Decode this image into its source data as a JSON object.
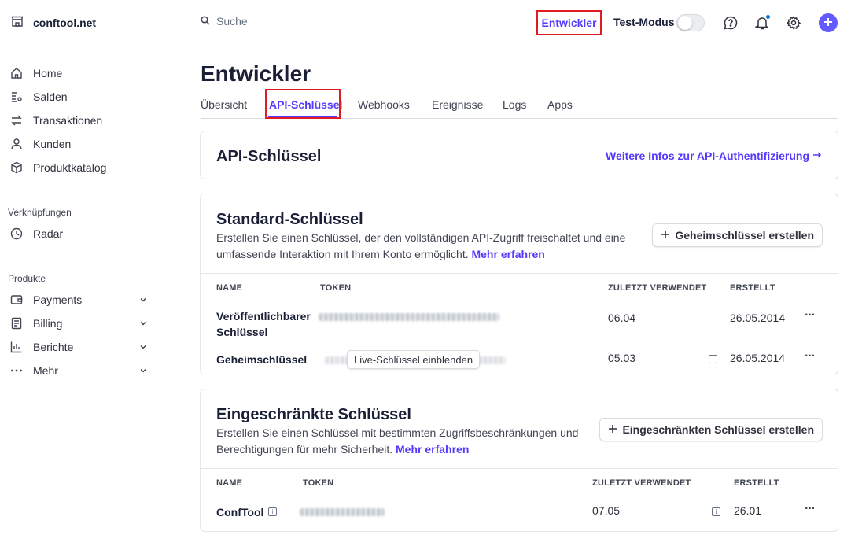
{
  "sidebar": {
    "account_name": "conftool.net",
    "nav": [
      {
        "label": "Home"
      },
      {
        "label": "Salden"
      },
      {
        "label": "Transaktionen"
      },
      {
        "label": "Kunden"
      },
      {
        "label": "Produktkatalog"
      }
    ],
    "shortcuts_label": "Verknüpfungen",
    "shortcuts": [
      {
        "label": "Radar"
      }
    ],
    "products_label": "Produkte",
    "products": [
      {
        "label": "Payments"
      },
      {
        "label": "Billing"
      },
      {
        "label": "Berichte"
      },
      {
        "label": "Mehr"
      }
    ]
  },
  "topbar": {
    "search_placeholder": "Suche",
    "developer_link": "Entwickler",
    "test_mode_label": "Test-Modus",
    "test_mode_on": false
  },
  "page": {
    "title": "Entwickler",
    "tabs": [
      {
        "label": "Übersicht"
      },
      {
        "label": "API-Schlüssel"
      },
      {
        "label": "Webhooks"
      },
      {
        "label": "Ereignisse"
      },
      {
        "label": "Logs"
      },
      {
        "label": "Apps"
      }
    ],
    "active_tab": "API-Schlüssel"
  },
  "api_card": {
    "title": "API-Schlüssel",
    "info_link": "Weitere Infos zur API-Authentifizierung"
  },
  "standard": {
    "title": "Standard-Schlüssel",
    "desc_line1": "Erstellen Sie einen Schlüssel, der den vollständigen API-Zugriff freischaltet und eine",
    "desc_line2": "umfassende Interaktion mit Ihrem Konto ermöglicht.",
    "learn_more": "Mehr erfahren",
    "button": "Geheimschlüssel erstellen",
    "columns": [
      "NAME",
      "TOKEN",
      "ZULETZT VERWENDET",
      "ERSTELLT"
    ],
    "rows": [
      {
        "name_line1": "Veröffentlichbarer",
        "name_line2": "Schlüssel",
        "last_used": "06.04",
        "created": "26.05.2014"
      },
      {
        "name": "Geheimschlüssel",
        "reveal": "Live-Schlüssel einblenden",
        "last_used": "05.03",
        "created": "26.05.2014"
      }
    ]
  },
  "restricted": {
    "title": "Eingeschränkte Schlüssel",
    "desc_line1": "Erstellen Sie einen Schlüssel mit bestimmten Zugriffsbeschränkungen und",
    "desc_line2": "Berechtigungen für mehr Sicherheit.",
    "learn_more": "Mehr erfahren",
    "button": "Eingeschränkten Schlüssel erstellen",
    "columns": [
      "NAME",
      "TOKEN",
      "ZULETZT VERWENDET",
      "ERSTELLT"
    ],
    "rows": [
      {
        "name": "ConfTool",
        "last_used": "07.05",
        "created": "26.01"
      }
    ]
  },
  "colors": {
    "accent": "#533afd",
    "highlight_box": "#e01b24"
  }
}
